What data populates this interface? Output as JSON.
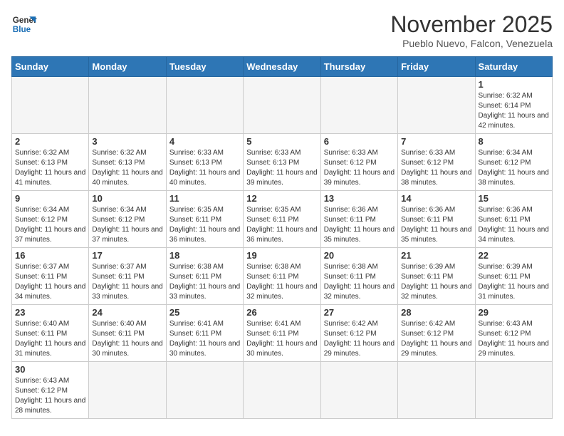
{
  "logo": {
    "text_general": "General",
    "text_blue": "Blue"
  },
  "header": {
    "month_year": "November 2025",
    "location": "Pueblo Nuevo, Falcon, Venezuela"
  },
  "weekdays": [
    "Sunday",
    "Monday",
    "Tuesday",
    "Wednesday",
    "Thursday",
    "Friday",
    "Saturday"
  ],
  "days": [
    {
      "date": "1",
      "sunrise": "6:32 AM",
      "sunset": "6:14 PM",
      "daylight": "11 hours and 42 minutes."
    },
    {
      "date": "2",
      "sunrise": "6:32 AM",
      "sunset": "6:13 PM",
      "daylight": "11 hours and 41 minutes."
    },
    {
      "date": "3",
      "sunrise": "6:32 AM",
      "sunset": "6:13 PM",
      "daylight": "11 hours and 40 minutes."
    },
    {
      "date": "4",
      "sunrise": "6:33 AM",
      "sunset": "6:13 PM",
      "daylight": "11 hours and 40 minutes."
    },
    {
      "date": "5",
      "sunrise": "6:33 AM",
      "sunset": "6:13 PM",
      "daylight": "11 hours and 39 minutes."
    },
    {
      "date": "6",
      "sunrise": "6:33 AM",
      "sunset": "6:12 PM",
      "daylight": "11 hours and 39 minutes."
    },
    {
      "date": "7",
      "sunrise": "6:33 AM",
      "sunset": "6:12 PM",
      "daylight": "11 hours and 38 minutes."
    },
    {
      "date": "8",
      "sunrise": "6:34 AM",
      "sunset": "6:12 PM",
      "daylight": "11 hours and 38 minutes."
    },
    {
      "date": "9",
      "sunrise": "6:34 AM",
      "sunset": "6:12 PM",
      "daylight": "11 hours and 37 minutes."
    },
    {
      "date": "10",
      "sunrise": "6:34 AM",
      "sunset": "6:12 PM",
      "daylight": "11 hours and 37 minutes."
    },
    {
      "date": "11",
      "sunrise": "6:35 AM",
      "sunset": "6:11 PM",
      "daylight": "11 hours and 36 minutes."
    },
    {
      "date": "12",
      "sunrise": "6:35 AM",
      "sunset": "6:11 PM",
      "daylight": "11 hours and 36 minutes."
    },
    {
      "date": "13",
      "sunrise": "6:36 AM",
      "sunset": "6:11 PM",
      "daylight": "11 hours and 35 minutes."
    },
    {
      "date": "14",
      "sunrise": "6:36 AM",
      "sunset": "6:11 PM",
      "daylight": "11 hours and 35 minutes."
    },
    {
      "date": "15",
      "sunrise": "6:36 AM",
      "sunset": "6:11 PM",
      "daylight": "11 hours and 34 minutes."
    },
    {
      "date": "16",
      "sunrise": "6:37 AM",
      "sunset": "6:11 PM",
      "daylight": "11 hours and 34 minutes."
    },
    {
      "date": "17",
      "sunrise": "6:37 AM",
      "sunset": "6:11 PM",
      "daylight": "11 hours and 33 minutes."
    },
    {
      "date": "18",
      "sunrise": "6:38 AM",
      "sunset": "6:11 PM",
      "daylight": "11 hours and 33 minutes."
    },
    {
      "date": "19",
      "sunrise": "6:38 AM",
      "sunset": "6:11 PM",
      "daylight": "11 hours and 32 minutes."
    },
    {
      "date": "20",
      "sunrise": "6:38 AM",
      "sunset": "6:11 PM",
      "daylight": "11 hours and 32 minutes."
    },
    {
      "date": "21",
      "sunrise": "6:39 AM",
      "sunset": "6:11 PM",
      "daylight": "11 hours and 32 minutes."
    },
    {
      "date": "22",
      "sunrise": "6:39 AM",
      "sunset": "6:11 PM",
      "daylight": "11 hours and 31 minutes."
    },
    {
      "date": "23",
      "sunrise": "6:40 AM",
      "sunset": "6:11 PM",
      "daylight": "11 hours and 31 minutes."
    },
    {
      "date": "24",
      "sunrise": "6:40 AM",
      "sunset": "6:11 PM",
      "daylight": "11 hours and 30 minutes."
    },
    {
      "date": "25",
      "sunrise": "6:41 AM",
      "sunset": "6:11 PM",
      "daylight": "11 hours and 30 minutes."
    },
    {
      "date": "26",
      "sunrise": "6:41 AM",
      "sunset": "6:11 PM",
      "daylight": "11 hours and 30 minutes."
    },
    {
      "date": "27",
      "sunrise": "6:42 AM",
      "sunset": "6:12 PM",
      "daylight": "11 hours and 29 minutes."
    },
    {
      "date": "28",
      "sunrise": "6:42 AM",
      "sunset": "6:12 PM",
      "daylight": "11 hours and 29 minutes."
    },
    {
      "date": "29",
      "sunrise": "6:43 AM",
      "sunset": "6:12 PM",
      "daylight": "11 hours and 29 minutes."
    },
    {
      "date": "30",
      "sunrise": "6:43 AM",
      "sunset": "6:12 PM",
      "daylight": "11 hours and 28 minutes."
    }
  ],
  "labels": {
    "sunrise": "Sunrise:",
    "sunset": "Sunset:",
    "daylight": "Daylight:"
  }
}
